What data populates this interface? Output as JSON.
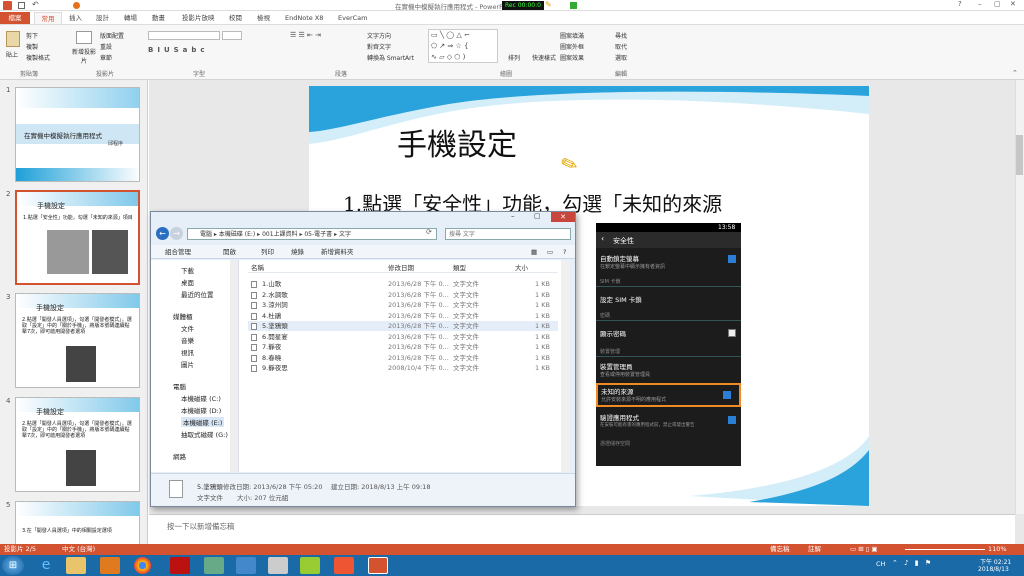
{
  "app": {
    "title": "在實機中模擬執行應用程式 - PowerPoint",
    "recorder": "Rec 00:00:0"
  },
  "ribbon_tabs": [
    "檔案",
    "常用",
    "插入",
    "設計",
    "轉場",
    "動畫",
    "投影片放映",
    "校閱",
    "檢視",
    "EndNote X8",
    "EverCam"
  ],
  "ribbon": {
    "groups": [
      "剪貼簿",
      "投影片",
      "字型",
      "段落",
      "繪圖",
      "編輯"
    ],
    "buttons": {
      "paste": "貼上",
      "cut": "剪下",
      "copy": "複製",
      "format_painter": "複製格式",
      "new_slide": "新增投影片",
      "layout": "版面配置",
      "reset": "重設",
      "section": "章節",
      "text_direction": "文字方向",
      "align_text": "對齊文字",
      "smartart": "轉換為 SmartArt",
      "arrange": "排列",
      "quick_styles": "快速樣式",
      "shape_fill": "圖案填滿",
      "shape_outline": "圖案外框",
      "shape_effects": "圖案效果",
      "find": "尋找",
      "replace": "取代",
      "select": "選取"
    }
  },
  "slides": [
    {
      "num": "1",
      "title": "在實機中模擬執行應用程式",
      "author": "邱程序"
    },
    {
      "num": "2",
      "title": "手機設定",
      "body": "1.點選「安全性」功能，勾選「未知的來源」項目"
    },
    {
      "num": "3",
      "title": "手機設定",
      "body": "2.點選「開發人員選項」，勾選「開發者模式」。選取「設定」中的「關於手機」，將版本號碼連續點擊7次，即可啟用開發者選項"
    },
    {
      "num": "4",
      "title": "手機設定",
      "body": "2.點選「開發人員選項」，勾選「開發者模式」。選取「設定」中的「關於手機」，將版本號碼連續點擊7次，即可啟用開發者選項"
    },
    {
      "num": "5",
      "body": "3.在「開發人員選項」中的相關設定選項"
    }
  ],
  "slide": {
    "title": "手機設定",
    "body": "1.點選「安全性」功能，勾選「未知的來源"
  },
  "phone": {
    "time": "13:58",
    "header": "安全性",
    "rows": [
      {
        "label": "自動鎖定螢幕",
        "sub": "在鎖定螢幕中顯示擁有者資訊",
        "checked": true
      },
      {
        "label": "SIM 卡鎖",
        "sub": ""
      },
      {
        "label": "設定 SIM 卡鎖",
        "sub": ""
      },
      {
        "label": "密碼",
        "sub": ""
      },
      {
        "label": "顯示密碼",
        "sub": "",
        "checked": false
      },
      {
        "label": "裝置管理",
        "sub": ""
      },
      {
        "label": "裝置管理員",
        "sub": "查看或停用裝置管理員"
      },
      {
        "label": "未知的來源",
        "sub": "允許安裝來源不明的應用程式",
        "checked": true
      },
      {
        "label": "驗證應用程式",
        "sub": "在安裝可能有害的應用程式前，禁止或發出警告",
        "checked": true
      },
      {
        "label": "憑證儲存空間",
        "sub": ""
      }
    ]
  },
  "explorer": {
    "breadcrumb": [
      "電腦",
      "本機磁碟 (E:)",
      "001上課資料",
      "05-電子書",
      "文字"
    ],
    "search_placeholder": "搜尋 文字",
    "toolbar": [
      "組合管理",
      "開啟",
      "列印",
      "燒錄",
      "新增資料夾"
    ],
    "columns": [
      "名稱",
      "修改日期",
      "類型",
      "大小"
    ],
    "tree": [
      "下載",
      "桌面",
      "最近的位置",
      "媒體櫃",
      "文件",
      "音樂",
      "視訊",
      "圖片",
      "電腦",
      "本機磁碟 (C:)",
      "本機磁碟 (D:)",
      "本機磁碟 (E:)",
      "抽取式磁碟 (G:)",
      "網路"
    ],
    "files": [
      {
        "name": "1.山歌",
        "date": "2013/6/28 下午 0...",
        "type": "文字文件",
        "size": "1 KB"
      },
      {
        "name": "2.水調歌",
        "date": "2013/6/28 下午 0...",
        "type": "文字文件",
        "size": "1 KB"
      },
      {
        "name": "3.涼州詞",
        "date": "2013/6/28 下午 0...",
        "type": "文字文件",
        "size": "1 KB"
      },
      {
        "name": "4.杜鵑",
        "date": "2013/6/28 下午 0...",
        "type": "文字文件",
        "size": "1 KB"
      },
      {
        "name": "5.塗鴉頭",
        "date": "2013/6/28 下午 0...",
        "type": "文字文件",
        "size": "1 KB"
      },
      {
        "name": "6.開星宴",
        "date": "2013/6/28 下午 0...",
        "type": "文字文件",
        "size": "1 KB"
      },
      {
        "name": "7.靜夜",
        "date": "2013/6/28 下午 0...",
        "type": "文字文件",
        "size": "1 KB"
      },
      {
        "name": "8.春曉",
        "date": "2013/6/28 下午 0...",
        "type": "文字文件",
        "size": "1 KB"
      },
      {
        "name": "9.靜夜思",
        "date": "2008/10/4 下午 0...",
        "type": "文字文件",
        "size": "1 KB"
      }
    ],
    "details": {
      "name": "5.塗鴉頭",
      "modified": "修改日期: 2013/6/28 下午 05:20",
      "created": "建立日期: 2018/8/13 上午 09:18",
      "type": "文字文件",
      "size": "大小: 207 位元組"
    }
  },
  "notes_placeholder": "按一下以新增備忘稿",
  "status": {
    "slide": "投影片 2/5",
    "lang": "中文 (台灣)",
    "notes": "備忘稿",
    "comments": "註解",
    "zoom": "110%"
  },
  "clock": {
    "time": "下午 02:21",
    "date": "2018/8/13",
    "lang": "CH"
  }
}
